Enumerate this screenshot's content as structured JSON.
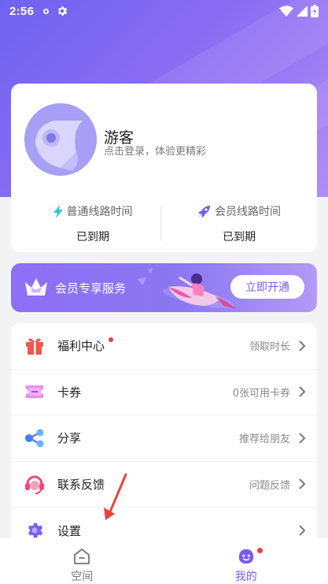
{
  "status_bar": {
    "time": "2:56",
    "icons": [
      "circle-dot-icon",
      "gear-icon",
      "wifi-icon",
      "signal-icon",
      "battery-icon"
    ]
  },
  "profile": {
    "name": "游客",
    "subtitle": "点击登录，体验更精彩",
    "avatar_icon": "bird-avatar-icon"
  },
  "lines": [
    {
      "label": "普通线路时间",
      "value": "已到期",
      "icon": "lightning-icon",
      "color": "#2ec7d6"
    },
    {
      "label": "会员线路时间",
      "value": "已到期",
      "icon": "rocket-icon",
      "color": "#7a5cf0"
    }
  ],
  "vip": {
    "title": "会员专享服务",
    "button": "立即开通",
    "icon": "crown-icon"
  },
  "menu": [
    {
      "label": "福利中心",
      "hint": "领取时长",
      "icon": "gift-icon",
      "has_dot": true
    },
    {
      "label": "卡券",
      "hint": "0张可用卡券",
      "icon": "ticket-icon",
      "has_dot": false
    },
    {
      "label": "分享",
      "hint": "推荐给朋友",
      "icon": "share-icon",
      "has_dot": false
    },
    {
      "label": "联系反馈",
      "hint": "问题反馈",
      "icon": "headset-icon",
      "has_dot": false
    },
    {
      "label": "设置",
      "hint": "",
      "icon": "settings-icon",
      "has_dot": false
    }
  ],
  "nav": [
    {
      "label": "空间",
      "icon": "home-icon",
      "active": false
    },
    {
      "label": "我的",
      "icon": "face-icon",
      "active": true,
      "badge": true
    }
  ],
  "colors": {
    "accent": "#7a5cf0",
    "badge": "#ee3b3b",
    "annotation_arrow": "#e8453c"
  }
}
